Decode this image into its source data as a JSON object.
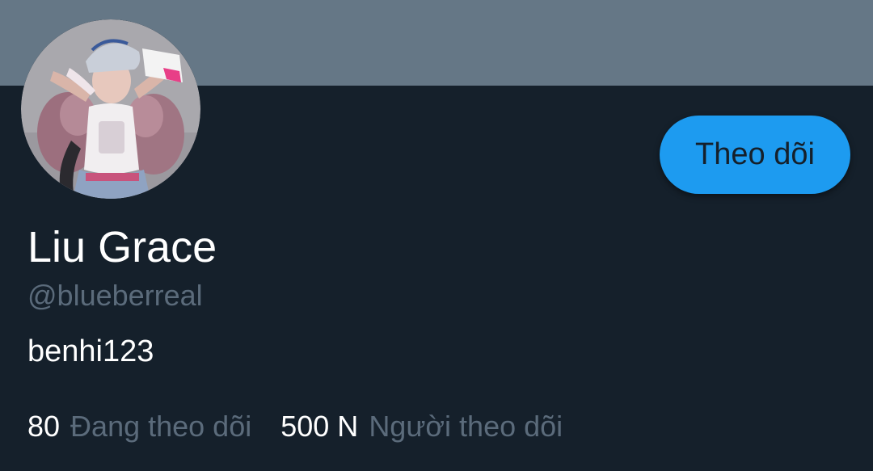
{
  "profile": {
    "display_name": "Liu Grace",
    "handle": "@blueberreal",
    "bio": "benhi123",
    "avatar_icon": "profile-photo"
  },
  "actions": {
    "follow_label": "Theo dõi"
  },
  "stats": {
    "following_count": "80",
    "following_label": "Đang theo dõi",
    "followers_count": "500 N",
    "followers_label": "Người theo dõi"
  },
  "colors": {
    "background": "#15202b",
    "banner": "#657786",
    "accent": "#1d9bf0",
    "secondary_text": "#5b6b7b",
    "primary_text": "#ffffff"
  }
}
